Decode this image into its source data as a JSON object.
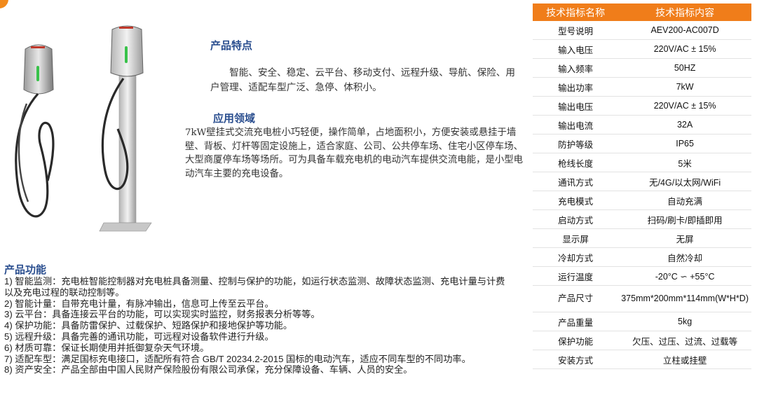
{
  "features": {
    "title": "产品特点",
    "text": "智能、安全、稳定、云平台、移动支付、远程升级、导航、保险、用户管理、适配车型广泛、急停、体积小。"
  },
  "applications": {
    "title": "应用领域",
    "text": "7kW壁挂式交流充电桩小巧轻便，操作简单，占地面积小，方便安装或悬挂于墙壁、背板、灯杆等固定设施上，适合家庭、公司、公共停车场、住宅小区停车场、大型商厦停车场等场所。可为具备车载充电机的电动汽车提供交流电能，是小型电动汽车主要的充电设备。"
  },
  "functions": {
    "title": "产品功能",
    "items": [
      "1) 智能监测：充电桩智能控制器对充电桩具备测量、控制与保护的功能，如运行状态监测、故障状态监测、充电计量与计费以及充电过程的联动控制等。",
      "2) 智能计量：自带充电计量，有脉冲输出，信息可上传至云平台。",
      "3) 云平台：具备连接云平台的功能，可以实现实时监控，财务报表分析等等。",
      "4) 保护功能：具备防雷保护、过载保护、短路保护和接地保护等功能。",
      "5) 远程升级：具备完善的通讯功能，可远程对设备软件进行升级。",
      "6) 材质可靠：保证长期使用并抵御复杂天气环境。",
      "7) 适配车型：满足国标充电接口，适配所有符合 GB/T 20234.2-2015 国标的电动汽车，适应不同车型的不同功率。",
      "8) 资产安全：产品全部由中国人民财产保险股份有限公司承保，充分保障设备、车辆、人员的安全。"
    ]
  },
  "spec_table": {
    "header": [
      "技术指标名称",
      "技术指标内容"
    ],
    "rows": [
      {
        "name": "型号说明",
        "value": "AEV200-AC007D"
      },
      {
        "name": "输入电压",
        "value": "220V/AC ± 15%"
      },
      {
        "name": "输入频率",
        "value": "50HZ"
      },
      {
        "name": "输出功率",
        "value": "7kW"
      },
      {
        "name": "输出电压",
        "value": "220V/AC ± 15%"
      },
      {
        "name": "输出电流",
        "value": "32A"
      },
      {
        "name": "防护等级",
        "value": "IP65"
      },
      {
        "name": "枪线长度",
        "value": "5米"
      },
      {
        "name": "通讯方式",
        "value": "无/4G/以太网/WiFi"
      },
      {
        "name": "充电模式",
        "value": "自动充满"
      },
      {
        "name": "启动方式",
        "value": "扫码/刷卡/即插即用"
      },
      {
        "name": "显示屏",
        "value": "无屏"
      },
      {
        "name": "冷却方式",
        "value": "自然冷却"
      },
      {
        "name": "运行温度",
        "value": "-20°C ∽ +55°C"
      },
      {
        "name": "产品尺寸",
        "value": "375mm*200mm*114mm(W*H*D)"
      },
      {
        "name": "产品重量",
        "value": "5kg"
      },
      {
        "name": "保护功能",
        "value": "欠压、过压、过流、过载等"
      },
      {
        "name": "安装方式",
        "value": "立柱或挂壁"
      }
    ]
  },
  "colors": {
    "accent": "#f07d1a",
    "heading": "#2a4e8f"
  }
}
